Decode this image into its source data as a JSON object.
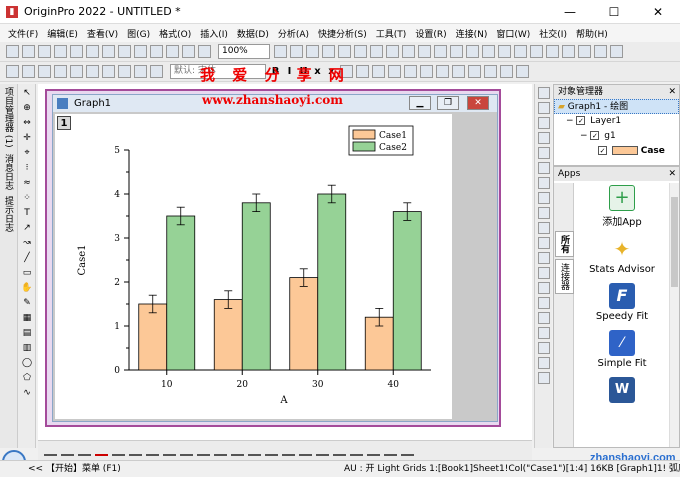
{
  "window": {
    "title": "OriginPro 2022 - UNTITLED *",
    "min": "—",
    "max": "☐",
    "close": "✕"
  },
  "menu": [
    "文件(F)",
    "编辑(E)",
    "查看(V)",
    "图(G)",
    "格式(O)",
    "插入(I)",
    "数据(D)",
    "分析(A)",
    "快捷分析(S)",
    "工具(T)",
    "设置(R)",
    "连接(N)",
    "窗口(W)",
    "社交(I)",
    "帮助(H)"
  ],
  "toolbar": {
    "zoom": "100%",
    "font": "默认: 宋体"
  },
  "watermark": {
    "cn": "我 爱 分 享 网",
    "url": "www.zhanshaoyi.com"
  },
  "left_vertical_labels": [
    "项目管理器 (1)",
    "消息日志",
    "提示日志"
  ],
  "graph": {
    "title": "Graph1",
    "layer_number": "1",
    "min": "▁",
    "max": "❐",
    "close": "✕"
  },
  "chart_data": {
    "type": "bar",
    "categories": [
      "10",
      "20",
      "30",
      "40"
    ],
    "series": [
      {
        "name": "Case1",
        "values": [
          1.5,
          1.6,
          2.1,
          1.2
        ],
        "errors": [
          0.2,
          0.2,
          0.2,
          0.2
        ],
        "color": "#fcc897"
      },
      {
        "name": "Case2",
        "values": [
          3.5,
          3.8,
          4.0,
          3.6
        ],
        "errors": [
          0.2,
          0.2,
          0.2,
          0.2
        ],
        "color": "#96d296"
      }
    ],
    "xlabel": "A",
    "ylabel": "Case1",
    "ylim": [
      0,
      5
    ],
    "yticks": [
      "0",
      "1",
      "2",
      "3",
      "4",
      "5"
    ],
    "legend": "top-right"
  },
  "object_manager": {
    "title": "对象管理器",
    "items": [
      "Graph1 - 绘图",
      "Layer1",
      "g1",
      "Case"
    ]
  },
  "apps": {
    "title": "Apps",
    "tabs": [
      "所有",
      "连接器"
    ],
    "list": [
      {
        "label": "添加App",
        "color": "#2e9e4a"
      },
      {
        "label": "Stats Advisor",
        "color": "#e8b32a"
      },
      {
        "label": "Speedy Fit",
        "color": "#2a5db0"
      },
      {
        "label": "Simple Fit",
        "color": "#2f63c7"
      }
    ]
  },
  "status": {
    "left": "<<  【开始】菜单 (F1)",
    "right": "AU : 开  Light Grids  1:[Book1]Sheet1!Col(\"Case1\")[1:4]  16KB  [Graph1]1! 弧度"
  },
  "site_credit": "zhanshaoyi.com"
}
